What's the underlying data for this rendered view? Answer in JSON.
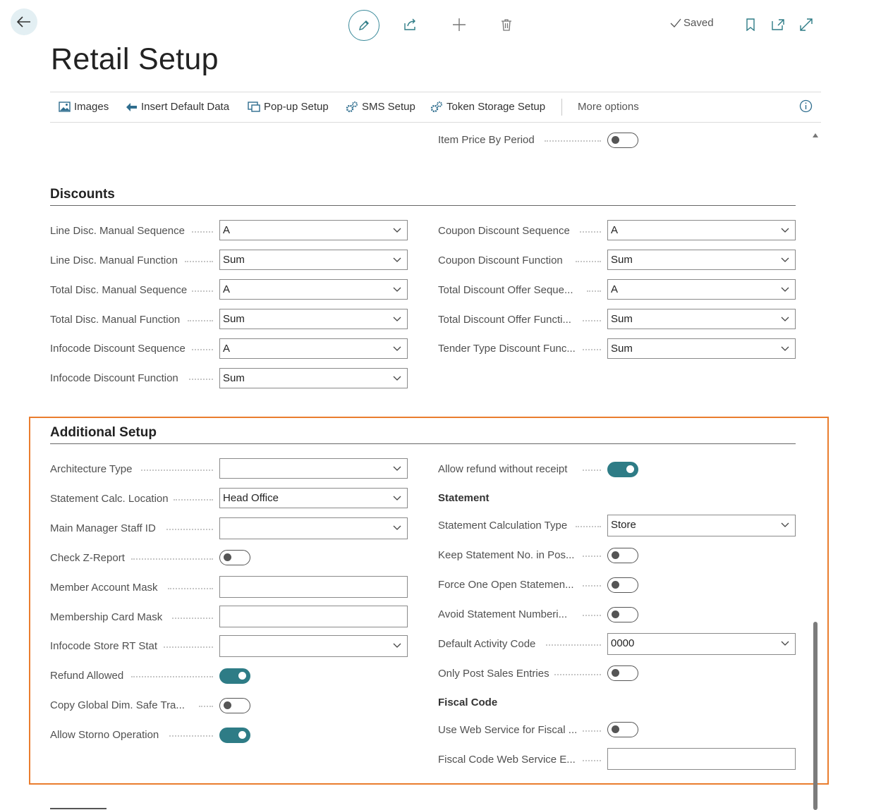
{
  "header": {
    "saved_label": "Saved"
  },
  "page": {
    "title": "Retail Setup"
  },
  "actions": [
    {
      "label": "Images",
      "icon": "image-icon"
    },
    {
      "label": "Insert Default Data",
      "icon": "arrow-left-icon"
    },
    {
      "label": "Pop-up Setup",
      "icon": "popup-icon"
    },
    {
      "label": "SMS Setup",
      "icon": "gears-icon"
    },
    {
      "label": "Token Storage Setup",
      "icon": "gears-icon"
    }
  ],
  "more_options": "More options",
  "top_fields": {
    "item_price_by_period": {
      "label": "Item Price By Period",
      "value": false
    }
  },
  "discounts": {
    "title": "Discounts",
    "left": [
      {
        "label": "Line Disc. Manual Sequence",
        "value": "A"
      },
      {
        "label": "Line Disc. Manual Function",
        "value": "Sum"
      },
      {
        "label": "Total Disc. Manual Sequence",
        "value": "A"
      },
      {
        "label": "Total Disc. Manual Function",
        "value": "Sum"
      },
      {
        "label": "Infocode Discount Sequence",
        "value": "A"
      },
      {
        "label": "Infocode Discount Function",
        "value": "Sum"
      }
    ],
    "right": [
      {
        "label": "Coupon Discount Sequence",
        "value": "A"
      },
      {
        "label": "Coupon Discount Function",
        "value": "Sum"
      },
      {
        "label": "Total Discount Offer Seque...",
        "value": "A"
      },
      {
        "label": "Total Discount Offer Functi...",
        "value": "Sum"
      },
      {
        "label": "Tender Type Discount Func...",
        "value": "Sum"
      }
    ]
  },
  "additional": {
    "title": "Additional Setup",
    "architecture_type": {
      "label": "Architecture Type",
      "value": ""
    },
    "statement_calc_location": {
      "label": "Statement Calc. Location",
      "value": "Head Office"
    },
    "main_manager_staff_id": {
      "label": "Main Manager Staff ID",
      "value": ""
    },
    "check_z_report": {
      "label": "Check Z-Report",
      "value": false
    },
    "member_account_mask": {
      "label": "Member Account Mask",
      "value": ""
    },
    "membership_card_mask": {
      "label": "Membership Card Mask",
      "value": ""
    },
    "infocode_store_rt_stat": {
      "label": "Infocode Store RT Stat",
      "value": ""
    },
    "refund_allowed": {
      "label": "Refund Allowed",
      "value": true
    },
    "copy_global_dim": {
      "label": "Copy Global Dim. Safe Tra...",
      "value": false
    },
    "allow_storno": {
      "label": "Allow Storno Operation",
      "value": true
    },
    "allow_refund_without_receipt": {
      "label": "Allow refund without receipt",
      "value": true
    },
    "statement_heading": "Statement",
    "statement_calc_type": {
      "label": "Statement Calculation Type",
      "value": "Store"
    },
    "keep_statement_no": {
      "label": "Keep Statement No. in Pos...",
      "value": false
    },
    "force_one_open": {
      "label": "Force One Open Statemen...",
      "value": false
    },
    "avoid_statement_numbering": {
      "label": "Avoid Statement Numberi...",
      "value": false
    },
    "default_activity_code": {
      "label": "Default Activity Code",
      "value": "0000"
    },
    "only_post_sales": {
      "label": "Only Post Sales Entries",
      "value": false
    },
    "fiscal_heading": "Fiscal Code",
    "use_web_service_fiscal": {
      "label": "Use Web Service for Fiscal ...",
      "value": false
    },
    "fiscal_code_web_service": {
      "label": "Fiscal Code Web Service E...",
      "value": ""
    }
  },
  "colors": {
    "accent": "#2e7c86",
    "highlight": "#ea7d2e"
  }
}
